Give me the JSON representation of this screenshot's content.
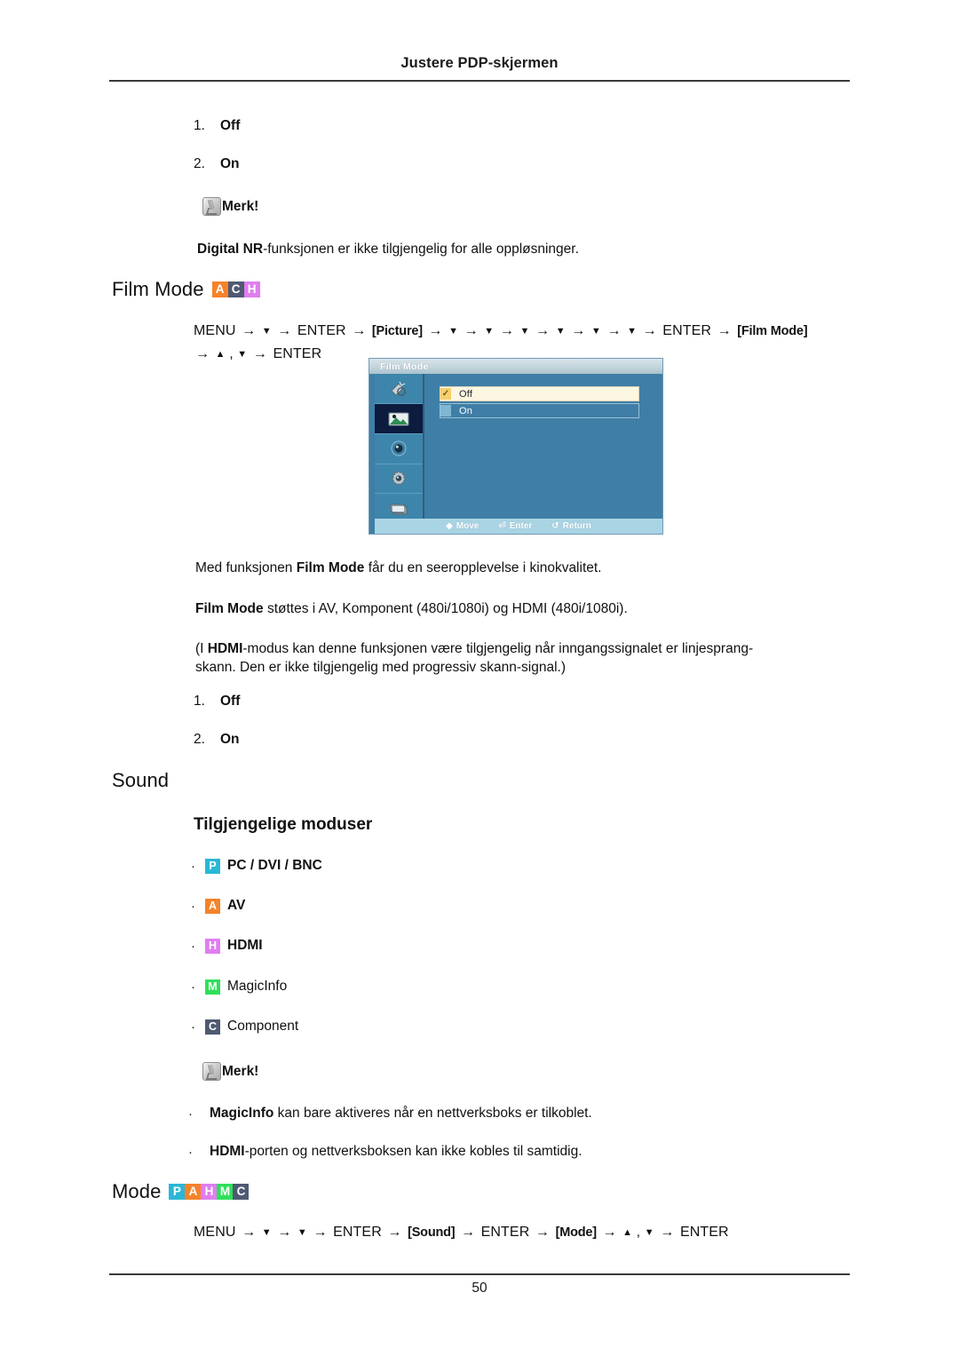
{
  "header": {
    "running_title": "Justere PDP-skjermen"
  },
  "footer": {
    "page_number": "50"
  },
  "top_list": {
    "items": [
      {
        "num": "1.",
        "value": "Off"
      },
      {
        "num": "2.",
        "value": "On"
      }
    ]
  },
  "note_top": {
    "icon": "note-pencil-icon",
    "label": "Merk!",
    "body_prefix": "Digital NR",
    "body_rest": "-funksjonen er ikke tilgjengelig for alle oppløsninger."
  },
  "film_mode": {
    "heading": "Film Mode",
    "badges": [
      {
        "letter": "A",
        "color": "#f5832a"
      },
      {
        "letter": "C",
        "color": "#4f5a72"
      },
      {
        "letter": "H",
        "color": "#e07ef0"
      }
    ],
    "path": {
      "line1": [
        {
          "t": "MENU",
          "k": "kw"
        },
        {
          "t": "→",
          "k": "arrow"
        },
        {
          "t": "▼",
          "k": "tri"
        },
        {
          "t": "→",
          "k": "arrow"
        },
        {
          "t": "ENTER",
          "k": "kw"
        },
        {
          "t": "→",
          "k": "arrow"
        },
        {
          "t": "[Picture]",
          "k": "tok"
        },
        {
          "t": "→",
          "k": "arrow"
        },
        {
          "t": "▼",
          "k": "tri"
        },
        {
          "t": "→",
          "k": "arrow"
        },
        {
          "t": "▼",
          "k": "tri"
        },
        {
          "t": "→",
          "k": "arrow"
        },
        {
          "t": "▼",
          "k": "tri"
        },
        {
          "t": "→",
          "k": "arrow"
        },
        {
          "t": "▼",
          "k": "tri"
        },
        {
          "t": "→",
          "k": "arrow"
        },
        {
          "t": "▼",
          "k": "tri"
        },
        {
          "t": "→",
          "k": "arrow"
        },
        {
          "t": "▼",
          "k": "tri"
        },
        {
          "t": "→",
          "k": "arrow"
        },
        {
          "t": "ENTER",
          "k": "kw"
        },
        {
          "t": "→",
          "k": "arrow"
        },
        {
          "t": "[Film Mode]",
          "k": "tok"
        }
      ],
      "line2": [
        {
          "t": "→",
          "k": "arrow"
        },
        {
          "t": "▲",
          "k": "tri"
        },
        {
          "t": ",",
          "k": "kw"
        },
        {
          "t": "▼",
          "k": "tri"
        },
        {
          "t": "→",
          "k": "arrow"
        },
        {
          "t": "ENTER",
          "k": "kw"
        }
      ]
    },
    "osd": {
      "title": "Film Mode",
      "sidebar_icons": [
        {
          "name": "input-source-icon",
          "selected": false
        },
        {
          "name": "picture-icon",
          "selected": true
        },
        {
          "name": "sound-icon",
          "selected": false
        },
        {
          "name": "setup-gear-icon",
          "selected": false
        },
        {
          "name": "multi-control-icon",
          "selected": false
        }
      ],
      "options": [
        {
          "label": "Off",
          "selected": true
        },
        {
          "label": "On",
          "selected": false
        }
      ],
      "hints": [
        {
          "glyph": "◆",
          "label": "Move"
        },
        {
          "glyph": "⏎",
          "label": "Enter"
        },
        {
          "glyph": "↺",
          "label": "Return"
        }
      ]
    },
    "paragraphs": {
      "p1_a": "Med funksjonen ",
      "p1_b": "Film Mode",
      "p1_c": " får du en seeropplevelse i kinokvalitet.",
      "p2_a": "Film Mode",
      "p2_b": " støttes i AV, Komponent (480i/1080i) og HDMI (480i/1080i).",
      "p3_a": "(I ",
      "p3_b": "HDMI",
      "p3_c": "-modus kan denne funksjonen være tilgjengelig når inngangssignalet er linjesprang-",
      "p3_d": "skann. Den er ikke tilgjengelig med progressiv skann-signal.)"
    },
    "option_list": [
      {
        "num": "1.",
        "value": "Off"
      },
      {
        "num": "2.",
        "value": "On"
      }
    ]
  },
  "sound": {
    "heading": "Sound",
    "subheading": "Tilgjengelige moduser",
    "modes": [
      {
        "badge": "P",
        "color": "#2ab7d6",
        "label": "PC / DVI / BNC",
        "bold": true
      },
      {
        "badge": "A",
        "color": "#f5832a",
        "label": "AV",
        "bold": true
      },
      {
        "badge": "H",
        "color": "#e07ef0",
        "label": "HDMI",
        "bold": true
      },
      {
        "badge": "M",
        "color": "#2fe05a",
        "label": "MagicInfo",
        "bold": false
      },
      {
        "badge": "C",
        "color": "#4f5a72",
        "label": "Component",
        "bold": false
      }
    ],
    "note": {
      "icon": "note-pencil-icon",
      "label": "Merk!",
      "bullets": [
        {
          "bold": "MagicInfo",
          "rest": " kan bare aktiveres når en nettverksboks er tilkoblet."
        },
        {
          "bold": "HDMI",
          "rest": "-porten og nettverksboksen kan ikke kobles til samtidig."
        }
      ]
    }
  },
  "mode": {
    "heading": "Mode",
    "badges": [
      {
        "letter": "P",
        "color": "#2ab7d6"
      },
      {
        "letter": "A",
        "color": "#f5832a"
      },
      {
        "letter": "H",
        "color": "#e07ef0"
      },
      {
        "letter": "M",
        "color": "#2fe05a"
      },
      {
        "letter": "C",
        "color": "#4f5a72"
      }
    ],
    "path": {
      "line1": [
        {
          "t": "MENU",
          "k": "kw"
        },
        {
          "t": "→",
          "k": "arrow"
        },
        {
          "t": "▼",
          "k": "tri"
        },
        {
          "t": "→",
          "k": "arrow"
        },
        {
          "t": "▼",
          "k": "tri"
        },
        {
          "t": "→",
          "k": "arrow"
        },
        {
          "t": "ENTER",
          "k": "kw"
        },
        {
          "t": "→",
          "k": "arrow"
        },
        {
          "t": "[Sound]",
          "k": "tok"
        },
        {
          "t": "→",
          "k": "arrow"
        },
        {
          "t": "ENTER",
          "k": "kw"
        },
        {
          "t": "→",
          "k": "arrow"
        },
        {
          "t": "[Mode]",
          "k": "tok"
        },
        {
          "t": "→",
          "k": "arrow"
        },
        {
          "t": "▲",
          "k": "tri"
        },
        {
          "t": ",",
          "k": "kw"
        },
        {
          "t": "▼",
          "k": "tri"
        },
        {
          "t": "→",
          "k": "arrow"
        },
        {
          "t": "ENTER",
          "k": "kw"
        }
      ]
    }
  }
}
